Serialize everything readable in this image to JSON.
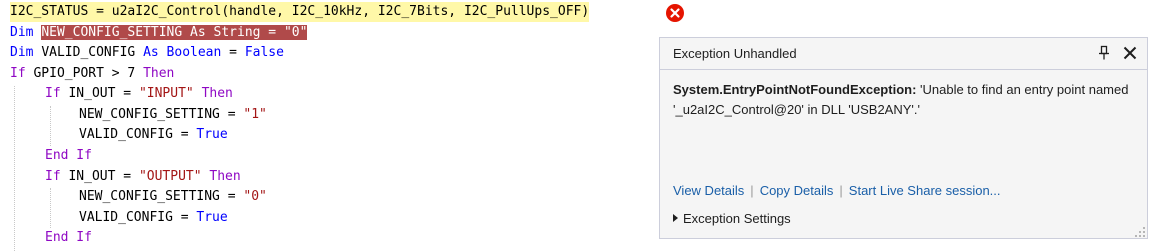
{
  "code": {
    "lines": [
      [
        {
          "t": "I2C_STATUS = u2aI2C_Control(handle, I2C_10kHz, I2C_7Bits, I2C_PullUps_OFF)",
          "c": "plain"
        }
      ],
      [
        {
          "t": "Dim ",
          "c": "kw"
        },
        {
          "t": "NEW_CONFIG_SETTING ",
          "c": "plain"
        },
        {
          "t": "As String",
          "c": "kw"
        },
        {
          "t": " = ",
          "c": "plain"
        },
        {
          "t": "\"0\"",
          "c": "str"
        }
      ],
      [
        {
          "t": "Dim ",
          "c": "kw"
        },
        {
          "t": "VALID_CONFIG ",
          "c": "plain"
        },
        {
          "t": "As Boolean",
          "c": "kw"
        },
        {
          "t": " = ",
          "c": "plain"
        },
        {
          "t": "False",
          "c": "kw"
        }
      ],
      [
        {
          "t": "If ",
          "c": "ctl"
        },
        {
          "t": "GPIO_PORT > 7 ",
          "c": "plain"
        },
        {
          "t": "Then",
          "c": "ctl"
        }
      ],
      [
        {
          "t": "If ",
          "c": "ctl"
        },
        {
          "t": "IN_OUT = ",
          "c": "plain"
        },
        {
          "t": "\"INPUT\"",
          "c": "str"
        },
        {
          "t": " ",
          "c": "plain"
        },
        {
          "t": "Then",
          "c": "ctl"
        }
      ],
      [
        {
          "t": "NEW_CONFIG_SETTING = ",
          "c": "plain"
        },
        {
          "t": "\"1\"",
          "c": "str"
        }
      ],
      [
        {
          "t": "VALID_CONFIG = ",
          "c": "plain"
        },
        {
          "t": "True",
          "c": "kw"
        }
      ],
      [
        {
          "t": "End If",
          "c": "ctl"
        }
      ],
      [
        {
          "t": "If ",
          "c": "ctl"
        },
        {
          "t": "IN_OUT = ",
          "c": "plain"
        },
        {
          "t": "\"OUTPUT\"",
          "c": "str"
        },
        {
          "t": " ",
          "c": "plain"
        },
        {
          "t": "Then",
          "c": "ctl"
        }
      ],
      [
        {
          "t": "NEW_CONFIG_SETTING = ",
          "c": "plain"
        },
        {
          "t": "\"0\"",
          "c": "str"
        }
      ],
      [
        {
          "t": "VALID_CONFIG = ",
          "c": "plain"
        },
        {
          "t": "True",
          "c": "kw"
        }
      ],
      [
        {
          "t": "End If",
          "c": "ctl"
        }
      ]
    ]
  },
  "exception": {
    "title": "Exception Unhandled",
    "type": "System.EntryPointNotFoundException:",
    "message": " 'Unable to find an entry point named '_u2aI2C_Control@20' in DLL 'USB2ANY'.'",
    "links": {
      "view_details": "View Details",
      "copy_details": "Copy Details",
      "live_share": "Start Live Share session..."
    },
    "settings_label": "Exception Settings"
  },
  "icons": {
    "error": "error-circle-icon",
    "pin": "pin-icon",
    "close": "close-icon",
    "expand": "expand-triangle-icon",
    "resize": "resize-grip-icon"
  },
  "colors": {
    "keyword": "#0000ff",
    "control_keyword": "#8f08c4",
    "string": "#a31515",
    "current_statement": "#fff8a8",
    "highlight": "#b04a4a",
    "error": "#e51400",
    "link": "#1a5fa8"
  }
}
